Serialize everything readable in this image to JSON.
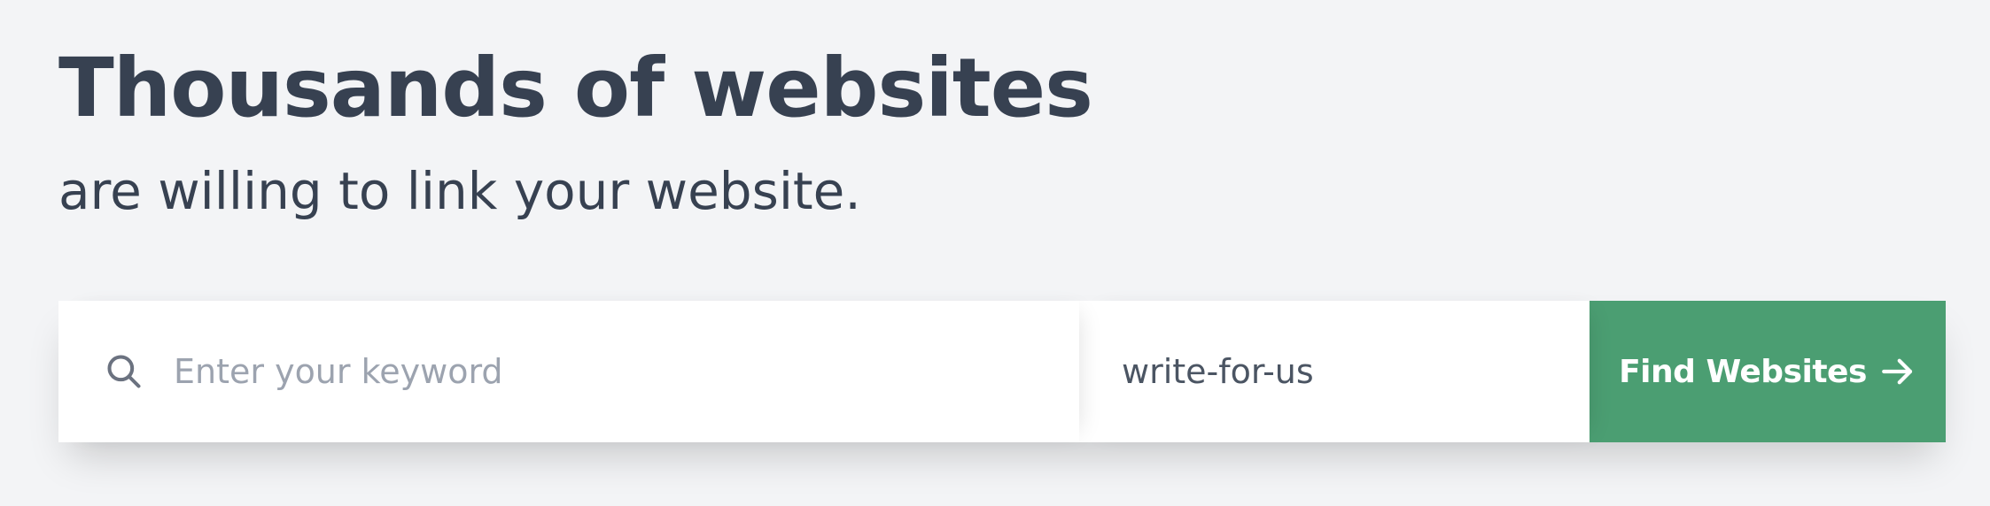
{
  "hero": {
    "headline": "Thousands of websites",
    "subheadline": "are willing to link your website."
  },
  "search": {
    "keyword_placeholder": "Enter your keyword",
    "keyword_value": "",
    "category_value": "write-for-us",
    "button_label": "Find Websites",
    "search_icon": "search-icon",
    "button_icon": "arrow-right-icon"
  },
  "colors": {
    "background": "#f3f4f6",
    "text": "#374151",
    "placeholder": "#9ca3af",
    "button": "#4b9e72",
    "button_text": "#ffffff"
  }
}
